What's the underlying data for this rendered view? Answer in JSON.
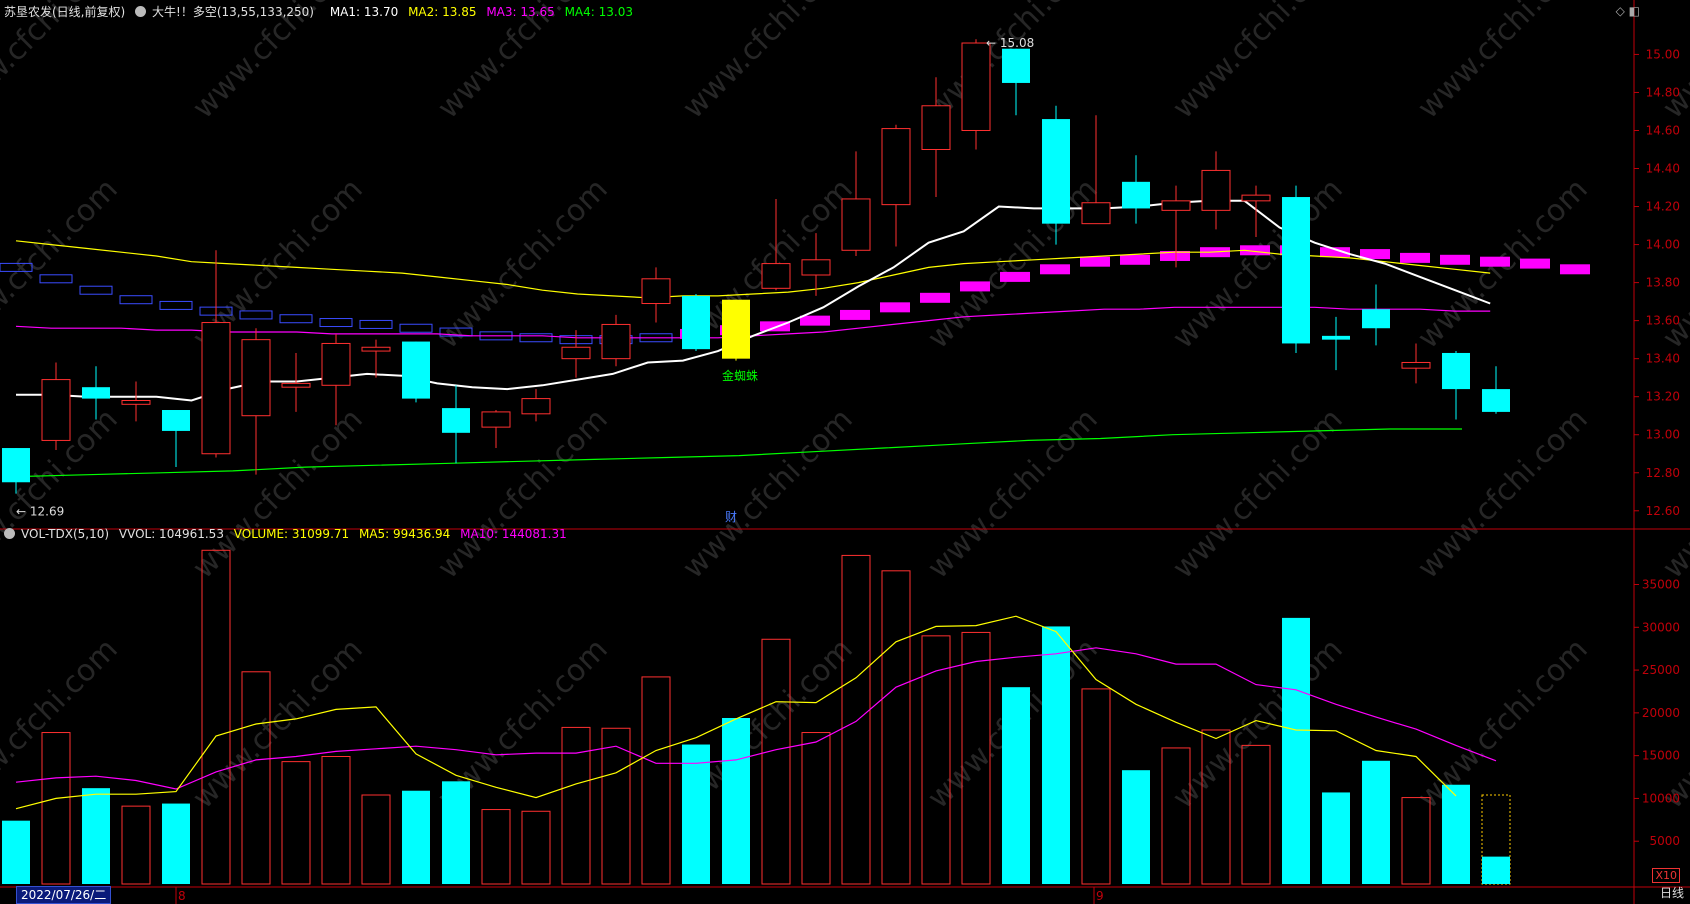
{
  "header": {
    "stock_name": "苏垦农发(日线,前复权)",
    "indicator_name": "大牛!！多空(13,55,133,250)",
    "ma1": "MA1: 13.70",
    "ma2": "MA2: 13.85",
    "ma3": "MA3: 13.65",
    "ma4": "MA4: 13.03"
  },
  "vol_header": {
    "name": "VOL-TDX(5,10)",
    "vvol": "VVOL: 104961.53",
    "volume": "VOLUME: 31099.71",
    "ma5": "MA5: 99436.94",
    "ma10": "MA10: 144081.31"
  },
  "footer": {
    "date": "2022/07/26/二",
    "month_marks": [
      "8",
      "9"
    ],
    "period": "日线",
    "scale_label": "X10"
  },
  "colors": {
    "up": "#ff3030",
    "down": "#00ffff",
    "ma1": "#ffffff",
    "ma2": "#ffff00",
    "ma3": "#ff00ff",
    "ma4": "#00ff00",
    "axis": "#c0000a"
  },
  "chart_data": [
    {
      "type": "candlestick",
      "title": "苏垦农发(日线,前复权)",
      "y_ticks": [
        "15.00",
        "14.80",
        "14.60",
        "14.40",
        "14.20",
        "14.00",
        "13.80",
        "13.60",
        "13.40",
        "13.20",
        "13.00",
        "12.80",
        "12.60"
      ],
      "ylim": [
        12.52,
        15.16
      ],
      "annotations": {
        "high_label": "15.08",
        "low_label": "12.69",
        "signal_text": "金蜘蛛",
        "finance_marker": "财"
      },
      "candles": [
        {
          "o": 12.93,
          "c": 12.75,
          "h": 12.93,
          "l": 12.69
        },
        {
          "o": 12.97,
          "c": 13.29,
          "h": 13.38,
          "l": 12.92
        },
        {
          "o": 13.25,
          "c": 13.19,
          "h": 13.36,
          "l": 13.08
        },
        {
          "o": 13.16,
          "c": 13.18,
          "h": 13.28,
          "l": 13.07
        },
        {
          "o": 13.13,
          "c": 13.02,
          "h": 13.13,
          "l": 12.83
        },
        {
          "o": 12.9,
          "c": 13.59,
          "h": 13.97,
          "l": 12.88
        },
        {
          "o": 13.1,
          "c": 13.5,
          "h": 13.56,
          "l": 12.79
        },
        {
          "o": 13.25,
          "c": 13.27,
          "h": 13.43,
          "l": 13.12
        },
        {
          "o": 13.26,
          "c": 13.48,
          "h": 13.53,
          "l": 13.05
        },
        {
          "o": 13.44,
          "c": 13.46,
          "h": 13.5,
          "l": 13.3
        },
        {
          "o": 13.49,
          "c": 13.19,
          "h": 13.49,
          "l": 13.17
        },
        {
          "o": 13.14,
          "c": 13.01,
          "h": 13.26,
          "l": 12.85
        },
        {
          "o": 13.04,
          "c": 13.12,
          "h": 13.13,
          "l": 12.93
        },
        {
          "o": 13.11,
          "c": 13.19,
          "h": 13.24,
          "l": 13.07
        },
        {
          "o": 13.4,
          "c": 13.46,
          "h": 13.55,
          "l": 13.3
        },
        {
          "o": 13.4,
          "c": 13.58,
          "h": 13.63,
          "l": 13.36
        },
        {
          "o": 13.69,
          "c": 13.82,
          "h": 13.88,
          "l": 13.59
        },
        {
          "o": 13.73,
          "c": 13.45,
          "h": 13.74,
          "l": 13.44
        },
        {
          "o": 13.71,
          "c": 13.4,
          "h": 13.71,
          "l": 13.39
        },
        {
          "o": 13.77,
          "c": 13.9,
          "h": 14.24,
          "l": 13.76
        },
        {
          "o": 13.84,
          "c": 13.92,
          "h": 14.06,
          "l": 13.73
        },
        {
          "o": 13.97,
          "c": 14.24,
          "h": 14.49,
          "l": 13.94
        },
        {
          "o": 14.21,
          "c": 14.61,
          "h": 14.63,
          "l": 13.99
        },
        {
          "o": 14.5,
          "c": 14.73,
          "h": 14.88,
          "l": 14.25
        },
        {
          "o": 14.6,
          "c": 15.06,
          "h": 15.08,
          "l": 14.5
        },
        {
          "o": 15.03,
          "c": 14.85,
          "h": 15.03,
          "l": 14.68
        },
        {
          "o": 14.66,
          "c": 14.11,
          "h": 14.73,
          "l": 14.0
        },
        {
          "o": 14.11,
          "c": 14.22,
          "h": 14.68,
          "l": 14.11
        },
        {
          "o": 14.33,
          "c": 14.19,
          "h": 14.47,
          "l": 14.11
        },
        {
          "o": 14.18,
          "c": 14.23,
          "h": 14.31,
          "l": 13.88
        },
        {
          "o": 14.18,
          "c": 14.39,
          "h": 14.49,
          "l": 14.08
        },
        {
          "o": 14.23,
          "c": 14.26,
          "h": 14.31,
          "l": 14.04
        },
        {
          "o": 14.25,
          "c": 13.48,
          "h": 14.31,
          "l": 13.43
        },
        {
          "o": 13.52,
          "c": 13.5,
          "h": 13.62,
          "l": 13.34
        },
        {
          "o": 13.66,
          "c": 13.56,
          "h": 13.79,
          "l": 13.47
        },
        {
          "o": 13.35,
          "c": 13.38,
          "h": 13.48,
          "l": 13.27
        },
        {
          "o": 13.43,
          "c": 13.24,
          "h": 13.44,
          "l": 13.08
        },
        {
          "o": 13.24,
          "c": 13.12,
          "h": 13.36,
          "l": 13.11
        }
      ],
      "ma1_values": [
        13.21,
        13.21,
        13.2,
        13.2,
        13.2,
        13.18,
        13.24,
        13.28,
        13.28,
        13.3,
        13.32,
        13.31,
        13.27,
        13.25,
        13.24,
        13.26,
        13.29,
        13.32,
        13.38,
        13.39,
        13.44,
        13.52,
        13.59,
        13.67,
        13.78,
        13.88,
        14.01,
        14.07,
        14.2,
        14.19,
        14.19,
        14.19,
        14.2,
        14.22,
        14.23,
        14.23,
        14.09,
        14.01,
        13.95,
        13.9,
        13.83,
        13.76,
        13.69
      ],
      "ma2_values": [
        14.02,
        14.0,
        13.98,
        13.96,
        13.94,
        13.91,
        13.9,
        13.89,
        13.88,
        13.87,
        13.86,
        13.85,
        13.83,
        13.81,
        13.79,
        13.76,
        13.74,
        13.73,
        13.72,
        13.73,
        13.73,
        13.74,
        13.75,
        13.77,
        13.8,
        13.84,
        13.88,
        13.9,
        13.91,
        13.92,
        13.93,
        13.94,
        13.95,
        13.96,
        13.96,
        13.97,
        13.95,
        13.94,
        13.93,
        13.91,
        13.89,
        13.87,
        13.85
      ],
      "ma3_values": [
        13.57,
        13.56,
        13.56,
        13.56,
        13.55,
        13.55,
        13.54,
        13.54,
        13.54,
        13.53,
        13.53,
        13.53,
        13.53,
        13.52,
        13.52,
        13.52,
        13.51,
        13.51,
        13.51,
        13.51,
        13.51,
        13.52,
        13.53,
        13.54,
        13.56,
        13.58,
        13.6,
        13.62,
        13.63,
        13.64,
        13.65,
        13.66,
        13.66,
        13.67,
        13.67,
        13.67,
        13.67,
        13.67,
        13.66,
        13.66,
        13.66,
        13.65,
        13.65
      ],
      "ma4_values": [
        12.78,
        12.79,
        12.8,
        12.81,
        12.83,
        12.84,
        12.85,
        12.86,
        12.87,
        12.88,
        12.89,
        12.91,
        12.93,
        12.95,
        12.97,
        12.98,
        13.0,
        13.01,
        13.02,
        13.03,
        13.03
      ],
      "band_values": [
        13.88,
        13.82,
        13.76,
        13.71,
        13.68,
        13.65,
        13.63,
        13.61,
        13.59,
        13.58,
        13.56,
        13.54,
        13.52,
        13.51,
        13.5,
        13.5,
        13.51,
        13.53,
        13.55,
        13.57,
        13.6,
        13.63,
        13.67,
        13.72,
        13.78,
        13.83,
        13.87,
        13.91,
        13.92,
        13.94,
        13.96,
        13.97,
        13.97,
        13.96,
        13.95,
        13.93,
        13.92,
        13.91,
        13.9,
        13.87
      ]
    },
    {
      "type": "bar",
      "title": "VOL-TDX(5,10)",
      "y_ticks": [
        "35000",
        "30000",
        "25000",
        "20000",
        "15000",
        "10000",
        "5000"
      ],
      "ylim": [
        0,
        39500
      ],
      "volumes": [
        7400,
        17700,
        11200,
        9100,
        9400,
        39000,
        24800,
        14300,
        14900,
        10400,
        10900,
        12000,
        8700,
        8500,
        18300,
        18200,
        24200,
        16300,
        19400,
        28600,
        17700,
        38400,
        36600,
        29000,
        29400,
        23000,
        30100,
        22800,
        13300,
        15900,
        18000,
        16200,
        31100,
        10700,
        14400,
        10100,
        11600,
        3200
      ],
      "ma5_values": [
        8800,
        10000,
        10500,
        10500,
        10800,
        17300,
        18700,
        19300,
        20400,
        20700,
        15200,
        12700,
        11300,
        10100,
        11700,
        13000,
        15600,
        17100,
        19300,
        21300,
        21200,
        24100,
        28300,
        30100,
        30200,
        31300,
        29500,
        23900,
        21000,
        18900,
        17000,
        19100,
        18000,
        17900,
        15600,
        14900,
        10300
      ],
      "ma10_values": [
        11900,
        12400,
        12600,
        12100,
        11100,
        13100,
        14500,
        14900,
        15500,
        15800,
        16100,
        15700,
        15100,
        15300,
        15300,
        16100,
        14100,
        14100,
        14500,
        15700,
        16600,
        19000,
        23000,
        24900,
        26000,
        26500,
        26900,
        27600,
        26900,
        25700,
        25700,
        23300,
        22700,
        21000,
        19500,
        18100,
        16200,
        14400
      ]
    }
  ]
}
